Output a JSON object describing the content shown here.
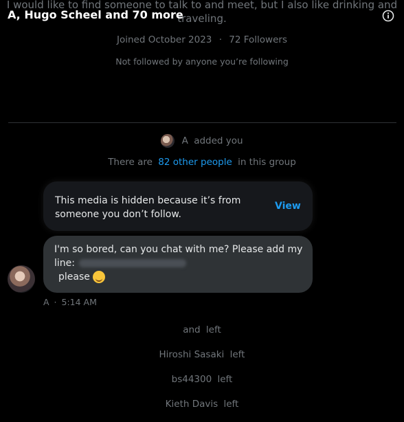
{
  "profile": {
    "bio_line1": "I would like to find someone to talk to and meet, but I also like drinking and",
    "bio_line2": "traveling.",
    "joined": "Joined October 2023",
    "separator": "·",
    "followers": "72 Followers",
    "not_followed": "Not followed by anyone you’re following"
  },
  "header": {
    "title": "A, Hugo Scheel and 70 more",
    "info_icon": "info-icon"
  },
  "events": {
    "added_name": "A",
    "added_text": "added you",
    "group_prefix": "There are",
    "group_link": "82 other people",
    "group_suffix": "in this group"
  },
  "hidden_media": {
    "text": "This media is hidden because it’s from someone you don’t follow.",
    "view_label": "View"
  },
  "message": {
    "line1": "I'm so bored, can you chat with me?  Please add my",
    "line2_label": "line:",
    "line3": "please",
    "emoji": "smiling-face-icon",
    "sender": "A",
    "dot": "·",
    "time": "5:14 AM"
  },
  "left_events": [
    {
      "name": "and",
      "action": "left"
    },
    {
      "name": "Hiroshi Sasaki",
      "action": "left"
    },
    {
      "name": "bs44300",
      "action": "left"
    },
    {
      "name": "Kieth Davis",
      "action": "left"
    }
  ],
  "colors": {
    "background": "#000000",
    "link": "#1d9bf0",
    "bubble": "#2f3336",
    "card": "#16181c",
    "muted": "#71767b"
  }
}
